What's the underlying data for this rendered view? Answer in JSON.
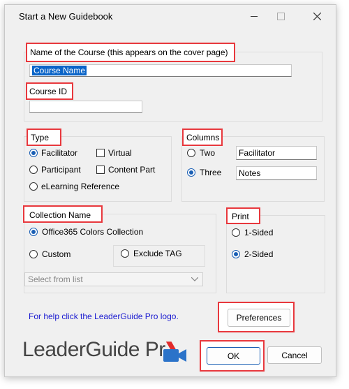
{
  "window": {
    "title": "Start a New Guidebook"
  },
  "course": {
    "name_label": "Name of the Course (this appears on the cover page)",
    "name_value": "Course Name",
    "id_label": "Course ID",
    "id_value": ""
  },
  "type": {
    "label": "Type",
    "facilitator": "Facilitator",
    "participant": "Participant",
    "elearning": "eLearning Reference",
    "virtual": "Virtual",
    "content_part": "Content Part"
  },
  "columns": {
    "label": "Columns",
    "two": "Two",
    "three": "Three",
    "col1_value": "Facilitator",
    "col2_value": "Notes"
  },
  "collection": {
    "label": "Collection Name",
    "office365": "Office365 Colors Collection",
    "custom": "Custom",
    "exclude_tag": "Exclude TAG",
    "select_placeholder": "Select from list"
  },
  "print": {
    "label": "Print",
    "one_sided": "1-Sided",
    "two_sided": "2-Sided"
  },
  "footer": {
    "help_text": "For help click the LeaderGuide Pro logo.",
    "preferences": "Preferences",
    "ok": "OK",
    "cancel": "Cancel",
    "logo_text": "LeaderGuide Pr"
  },
  "colors": {
    "highlight": "#e8383d",
    "help_link": "#1a1ad0",
    "accent": "#1a5fb4",
    "video_icon": "#2b73c9"
  }
}
